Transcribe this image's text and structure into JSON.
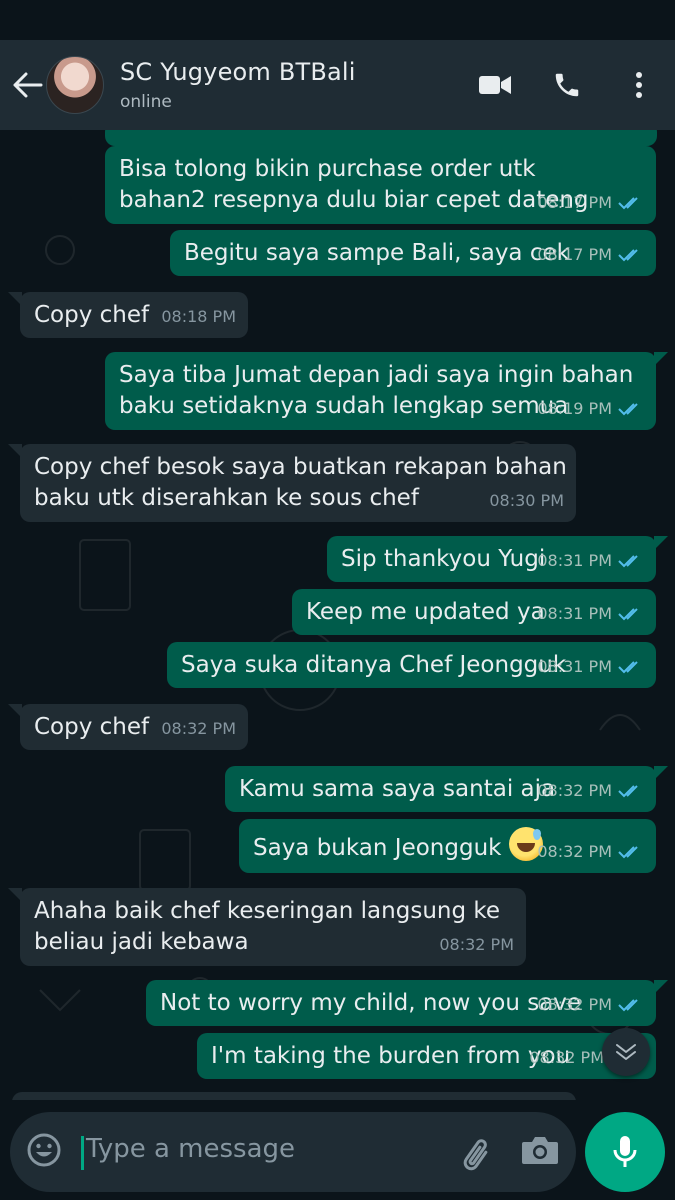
{
  "header": {
    "contact_name": "SC Yugyeom BTBali",
    "contact_status": "online"
  },
  "messages": [
    {
      "direction": "out",
      "text": "Bisa tolong bikin purchase order utk bahan2 resepnya dulu biar cepet dateng",
      "time": "08:17 PM",
      "read": true
    },
    {
      "direction": "out",
      "text": "Begitu saya sampe Bali, saya cek",
      "time": "08:17 PM",
      "read": true
    },
    {
      "direction": "in",
      "text": "Copy chef",
      "time": "08:18 PM"
    },
    {
      "direction": "out",
      "text": "Saya tiba Jumat depan jadi saya ingin bahan baku setidaknya sudah lengkap semua",
      "time": "08:19 PM",
      "read": true
    },
    {
      "direction": "in",
      "text": "Copy chef besok saya buatkan rekapan bahan baku utk diserahkan ke sous chef",
      "time": "08:30 PM"
    },
    {
      "direction": "out",
      "text": "Sip thankyou Yugi",
      "time": "08:31 PM",
      "read": true
    },
    {
      "direction": "out",
      "text": "Keep me updated ya",
      "time": "08:31 PM",
      "read": true
    },
    {
      "direction": "out",
      "text": "Saya suka ditanya Chef Jeongguk",
      "time": "08:31 PM",
      "read": true
    },
    {
      "direction": "in",
      "text": "Copy chef",
      "time": "08:32 PM"
    },
    {
      "direction": "out",
      "text": "Kamu sama saya santai aja",
      "time": "08:32 PM",
      "read": true
    },
    {
      "direction": "out",
      "text": "Saya bukan Jeongguk",
      "emoji": "sweat-smile-emoji",
      "time": "08:32 PM",
      "read": true
    },
    {
      "direction": "in",
      "text": "Ahaha baik chef keseringan langsung ke beliau jadi kebawa",
      "time": "08:32 PM"
    },
    {
      "direction": "out",
      "text": "Not to worry my child, now you save",
      "time": "08:32 PM",
      "read": true
    },
    {
      "direction": "out",
      "text": "I'm taking the burden from you",
      "time": "08:32 PM",
      "read": true
    }
  ],
  "composer": {
    "placeholder": "Type a message"
  },
  "colors": {
    "header_bg": "#1f2c34",
    "outgoing_bubble": "#005c4b",
    "incoming_bubble": "#202c33",
    "read_ticks": "#53bdeb",
    "accent": "#00a884"
  },
  "icons": [
    "back-arrow-icon",
    "video-call-icon",
    "voice-call-icon",
    "more-options-icon",
    "emoji-icon",
    "attach-icon",
    "camera-icon",
    "mic-icon",
    "scroll-down-icon",
    "read-ticks-icon"
  ]
}
